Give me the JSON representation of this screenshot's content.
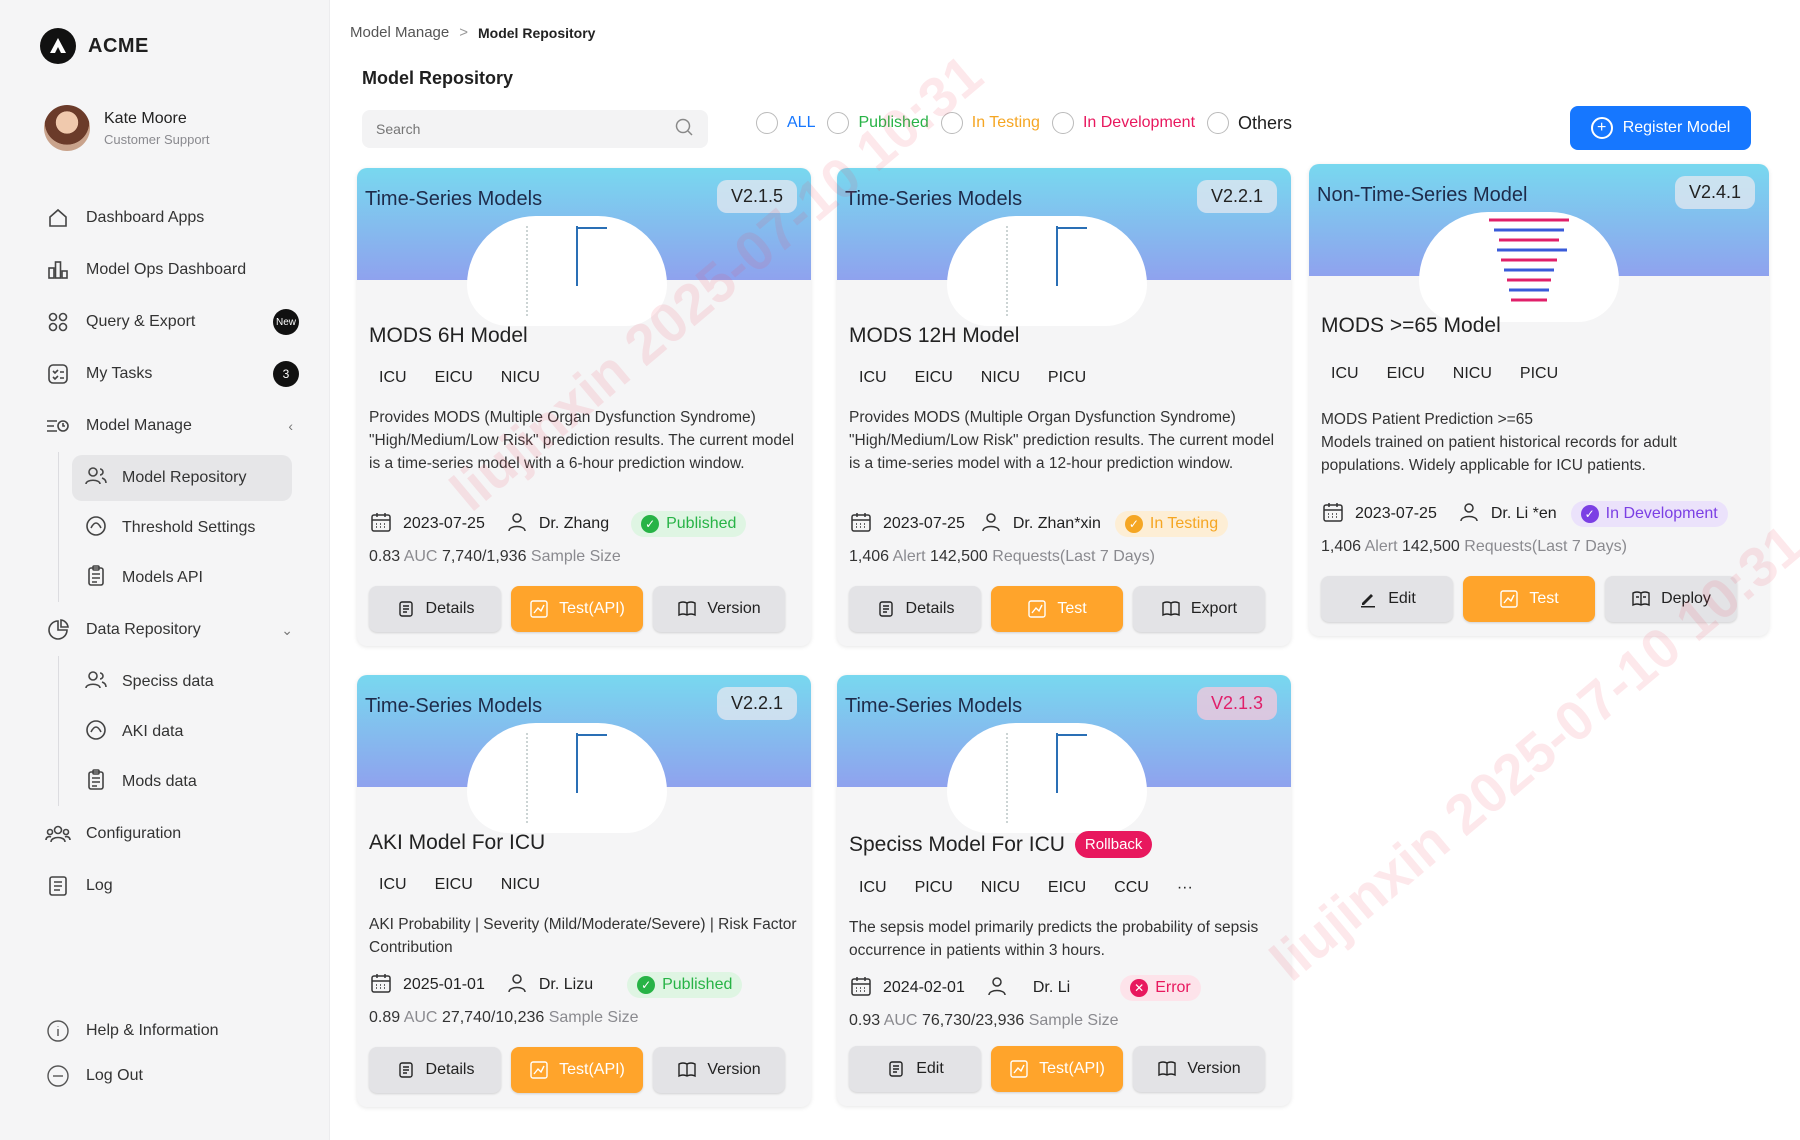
{
  "brand": {
    "name": "ACME"
  },
  "user": {
    "name": "Kate Moore",
    "role": "Customer Support"
  },
  "nav": {
    "dashboard_apps": "Dashboard Apps",
    "model_ops_dashboard": "Model Ops Dashboard",
    "query_export": "Query & Export",
    "query_export_badge": "New",
    "my_tasks": "My Tasks",
    "my_tasks_badge": "3",
    "model_manage": "Model Manage",
    "model_repository": "Model Repository",
    "threshold_settings": "Threshold Settings",
    "models_api": "Models API",
    "data_repository": "Data Repository",
    "speciss_data": "Speciss data",
    "aki_data": "AKI data",
    "mods_data": "Mods data",
    "configuration": "Configuration",
    "log": "Log",
    "help": "Help & Information",
    "logout": "Log Out"
  },
  "breadcrumb": {
    "parent": "Model Manage",
    "sep": ">",
    "current": "Model Repository"
  },
  "page": {
    "title": "Model  Repository"
  },
  "search": {
    "placeholder": "Search"
  },
  "filters": [
    {
      "label": "ALL",
      "color": "#1677ff"
    },
    {
      "label": "Published",
      "color": "#27b346"
    },
    {
      "label": "In Testing",
      "color": "#f5a623"
    },
    {
      "label": "In Development",
      "color": "#e8185e"
    },
    {
      "label": "Others",
      "color": "#222222"
    }
  ],
  "register_label": "Register Model",
  "cards": [
    {
      "category": "Time-Series Models",
      "version": "V2.1.5",
      "title": "MODS 6H Model",
      "tags": [
        "ICU",
        "EICU",
        "NICU"
      ],
      "desc": "Provides MODS (Multiple Organ Dysfunction Syndrome) \"High/Medium/Low Risk\" prediction results. The current model is a time-series model with a 6-hour prediction window.",
      "date": "2023-07-25",
      "owner": "Dr. Zhang",
      "status": "Published",
      "metric_value": "0.83",
      "metric_label": "AUC",
      "count_value": "7,740/1,936",
      "count_label": "Sample Size",
      "buttons": [
        "Details",
        "Test(API)",
        "Version"
      ]
    },
    {
      "category": "Time-Series Models",
      "version": "V2.2.1",
      "title": "MODS 12H Model",
      "tags": [
        "ICU",
        "EICU",
        "NICU",
        "PICU"
      ],
      "desc": "Provides MODS (Multiple Organ Dysfunction Syndrome) \"High/Medium/Low Risk\" prediction results. The current model is a time-series model with a 12-hour prediction window.",
      "date": "2023-07-25",
      "owner": "Dr. Zhan*xin",
      "status": "In Testing",
      "metric_value": "1,406",
      "metric_label": "Alert",
      "count_value": "142,500",
      "count_label": "Requests(Last 7 Days)",
      "buttons": [
        "Details",
        "Test",
        "Export"
      ]
    },
    {
      "category": "Non-Time-Series Model",
      "version": "V2.4.1",
      "title": "MODS >=65 Model",
      "tags": [
        "ICU",
        "EICU",
        "NICU",
        "PICU"
      ],
      "desc": "MODS Patient Prediction >=65\nModels trained on patient historical records for adult populations. Widely applicable for ICU patients.",
      "date": "2023-07-25",
      "owner": "Dr. Li *en",
      "status": "In Development",
      "metric_value": "1,406",
      "metric_label": "Alert",
      "count_value": "142,500",
      "count_label": "Requests(Last 7 Days)",
      "buttons": [
        "Edit",
        "Test",
        "Deploy"
      ]
    },
    {
      "category": "Time-Series Models",
      "version": "V2.2.1",
      "title": "AKI Model For ICU",
      "tags": [
        "ICU",
        "EICU",
        "NICU"
      ],
      "desc": "AKI Probability | Severity (Mild/Moderate/Severe) | Risk Factor Contribution",
      "date": "2025-01-01",
      "owner": "Dr. Lizu",
      "status": "Published",
      "metric_value": "0.89",
      "metric_label": "AUC",
      "count_value": "27,740/10,236",
      "count_label": "Sample Size",
      "buttons": [
        "Details",
        "Test(API)",
        "Version"
      ]
    },
    {
      "category": "Time-Series Models",
      "version": "V2.1.3",
      "title": "Speciss Model  For ICU",
      "rollback": "Rollback",
      "tags": [
        "ICU",
        "PICU",
        "NICU",
        "EICU",
        "CCU",
        "···"
      ],
      "desc": "The sepsis model primarily predicts the probability of sepsis occurrence in patients within 3 hours.",
      "date": "2024-02-01",
      "owner": "Dr. Li",
      "status": "Error",
      "metric_value": "0.93",
      "metric_label": "AUC",
      "count_value": "76,730/23,936",
      "count_label": "Sample Size",
      "buttons": [
        "Edit",
        "Test(API)",
        "Version"
      ]
    }
  ],
  "watermark": "liujinxin 2025-07-10 10:31"
}
